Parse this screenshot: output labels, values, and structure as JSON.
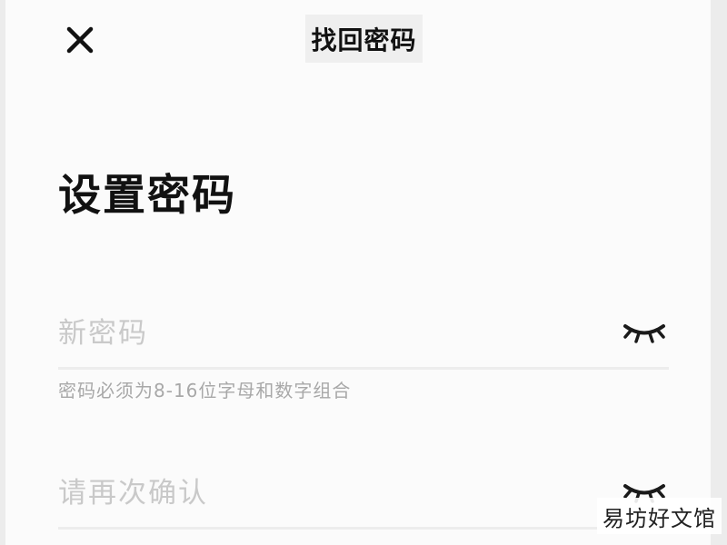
{
  "header": {
    "title": "找回密码"
  },
  "page": {
    "heading": "设置密码"
  },
  "form": {
    "new_password": {
      "placeholder": "新密码",
      "value": ""
    },
    "hint": "密码必须为8-16位字母和数字组合",
    "confirm_password": {
      "placeholder": "请再次确认",
      "value": ""
    }
  },
  "icons": {
    "close": "close-icon",
    "eye": "eye-closed-icon"
  },
  "watermark": "易坊好文馆"
}
